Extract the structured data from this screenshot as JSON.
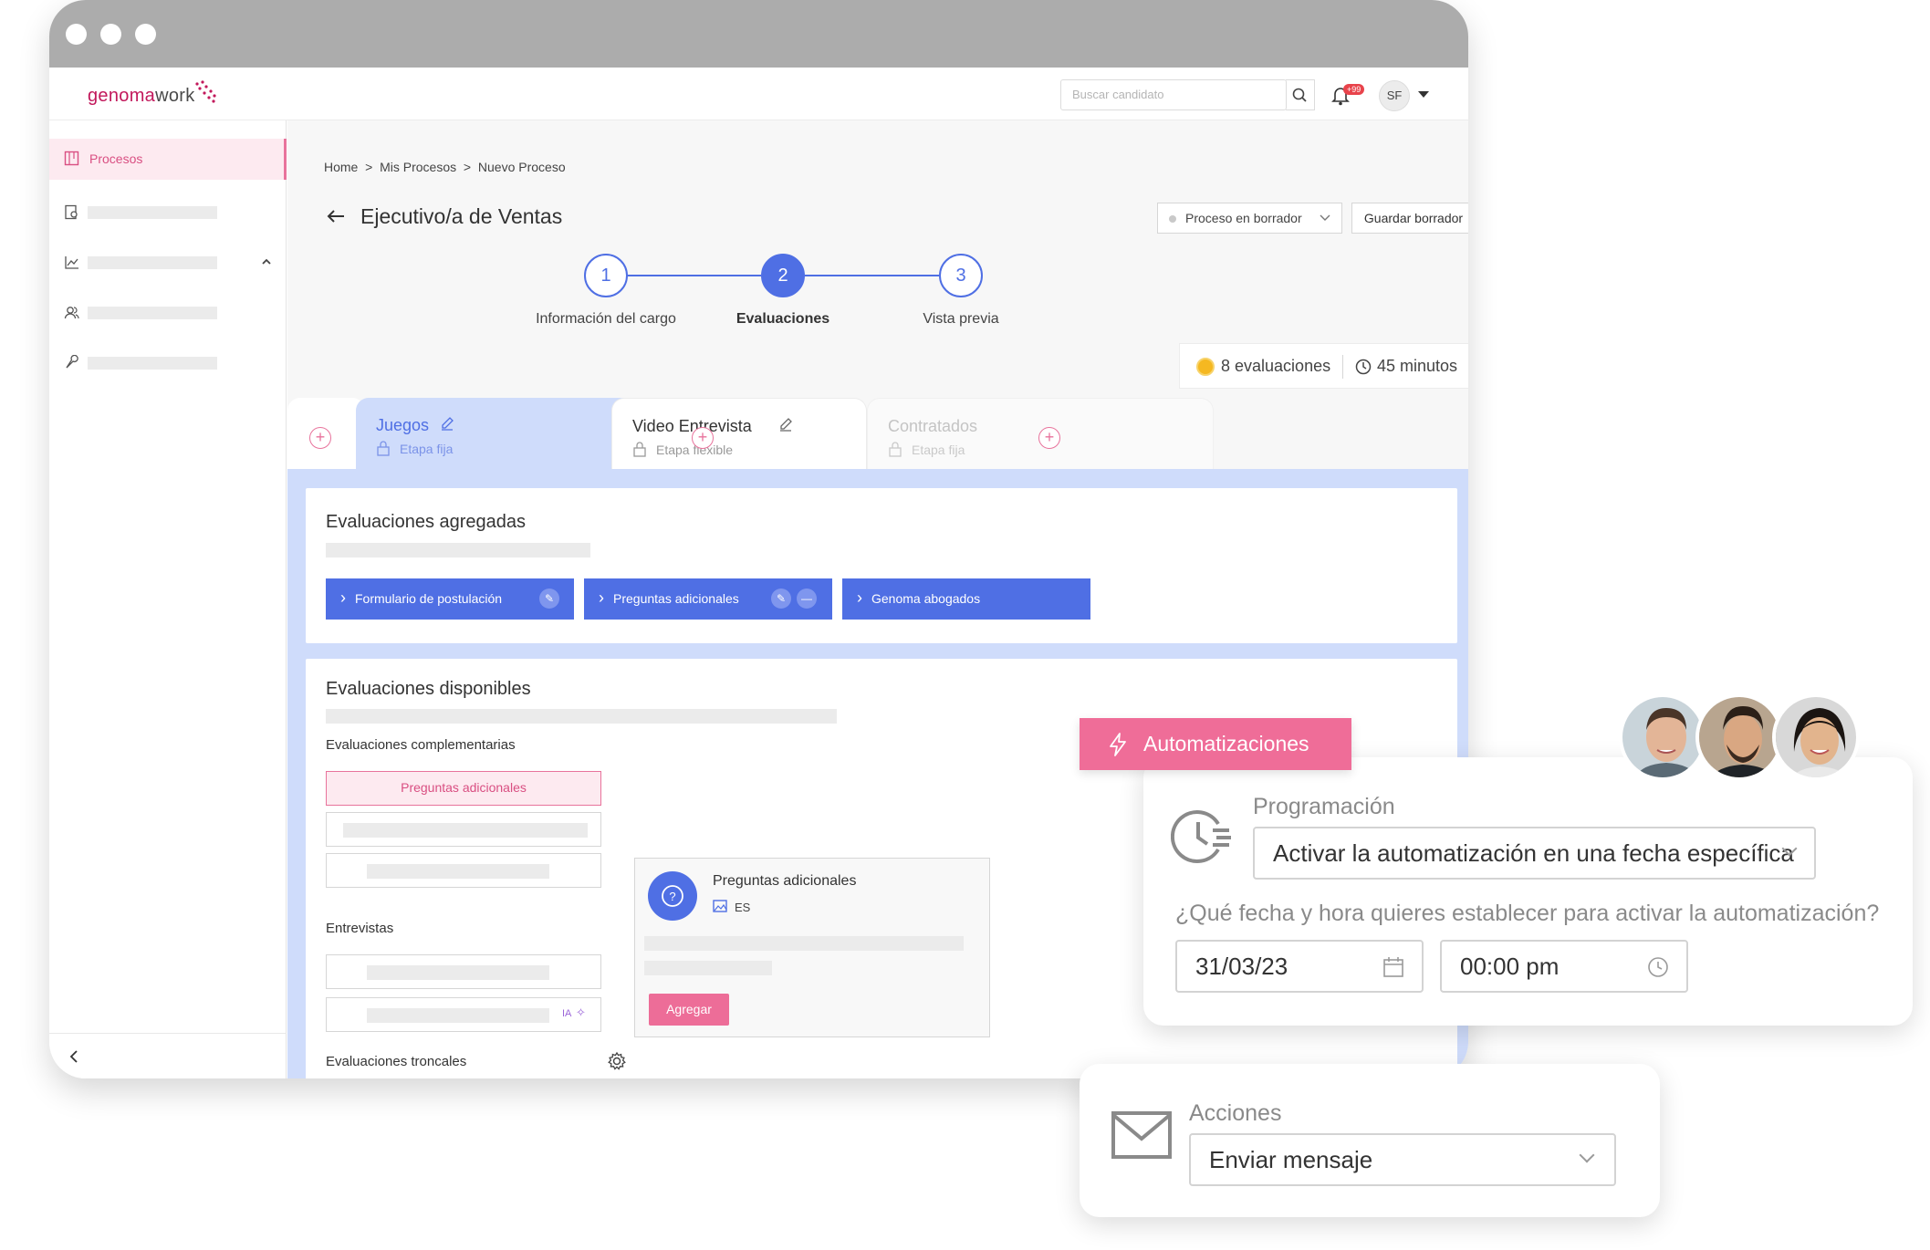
{
  "app": {
    "brand_genoma": "genoma",
    "brand_work": "work",
    "search_placeholder": "Buscar candidato",
    "notifications_badge": "+99",
    "user_initials": "SF"
  },
  "sidebar": {
    "active_label": "Procesos",
    "collapse_icon": "chevron-left-icon"
  },
  "breadcrumb": [
    "Home",
    ">",
    "Mis Procesos",
    ">",
    "Nuevo Proceso"
  ],
  "page": {
    "title": "Ejecutivo/a de Ventas",
    "status_select": "Proceso en borrador",
    "save_button": "Guardar borrador"
  },
  "steps": [
    {
      "number": "1",
      "label": "Información del cargo"
    },
    {
      "number": "2",
      "label": "Evaluaciones"
    },
    {
      "number": "3",
      "label": "Vista previa"
    }
  ],
  "summary": {
    "evaluations": "8 evaluaciones",
    "duration": "45 minutos"
  },
  "stage_tabs": [
    {
      "title": "Juegos",
      "subtitle": "Etapa fija"
    },
    {
      "title": "Video Entrevista",
      "subtitle": "Etapa flexible"
    },
    {
      "title": "Contratados",
      "subtitle": "Etapa fija"
    }
  ],
  "added": {
    "heading": "Evaluaciones agregadas",
    "chips": [
      "Formulario de postulación",
      "Preguntas adicionales",
      "Genoma abogados"
    ]
  },
  "available": {
    "heading": "Evaluaciones disponibles",
    "complementary_heading": "Evaluaciones complementarias",
    "selected_item": "Preguntas adicionales",
    "interviews_heading": "Entrevistas",
    "ai_tag": "IA",
    "trunk_heading": "Evaluaciones troncales",
    "detail_title": "Preguntas adicionales",
    "detail_lang": "ES",
    "add_button": "Agregar"
  },
  "automation": {
    "button": "Automatizaciones",
    "schedule_label": "Programación",
    "schedule_value": "Activar la automatización en una fecha específica",
    "question": "¿Qué fecha y hora quieres establecer para activar la automatización?",
    "date": "31/03/23",
    "time": "00:00 pm",
    "actions_label": "Acciones",
    "action_value": "Enviar mensaje"
  },
  "colors": {
    "accent_blue": "#4f6fe4",
    "accent_pink": "#ef6d98",
    "panel_blue": "#cfdcfb",
    "titlebar_gray": "#acacac"
  }
}
